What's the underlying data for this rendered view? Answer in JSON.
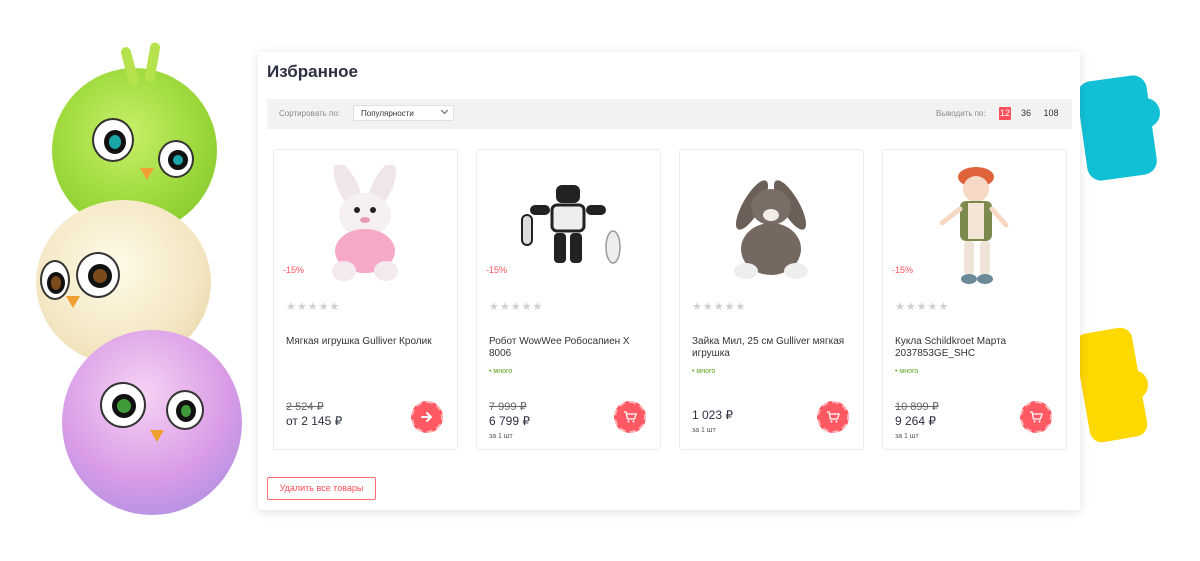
{
  "page": {
    "title": "Избранное"
  },
  "toolbar": {
    "sort_label": "Сортировать по:",
    "sort_value": "Популярности",
    "per_page_label": "Выводить по:",
    "per_page_options": [
      "12",
      "36",
      "108"
    ],
    "per_page_active": "12"
  },
  "products": [
    {
      "discount": "-15%",
      "name": "Мягкая игрушка Gulliver Кролик",
      "stock": "",
      "old_price": "2 524 ₽",
      "new_price": "от 2 145 ₽",
      "unit": "",
      "rating": 0,
      "action_icon": "arrow-right-icon"
    },
    {
      "discount": "-15%",
      "name": "Робот WowWee Робосапиен X 8006",
      "stock": "• много",
      "old_price": "7 999 ₽",
      "new_price": "6 799 ₽",
      "unit": "за 1 шт",
      "rating": 0,
      "action_icon": "cart-icon"
    },
    {
      "discount": "",
      "name": "Зайка Мил, 25 см Gulliver мягкая игрушка",
      "stock": "• много",
      "old_price": "",
      "new_price": "1 023 ₽",
      "unit": "за 1 шт",
      "rating": 0,
      "action_icon": "cart-icon"
    },
    {
      "discount": "-15%",
      "name": "Кукла Schildkroet Марта 2037853GE_SHC",
      "stock": "• много",
      "old_price": "10 899 ₽",
      "new_price": "9 264 ₽",
      "unit": "за 1 шт",
      "rating": 0,
      "action_icon": "cart-icon"
    }
  ],
  "stars_glyphs": "★★★★★",
  "footer": {
    "remove_all_label": "Удалить все товары"
  },
  "colors": {
    "accent": "#ff4f5a",
    "stock_green": "#5aa51c",
    "title_text": "#2c3040"
  }
}
